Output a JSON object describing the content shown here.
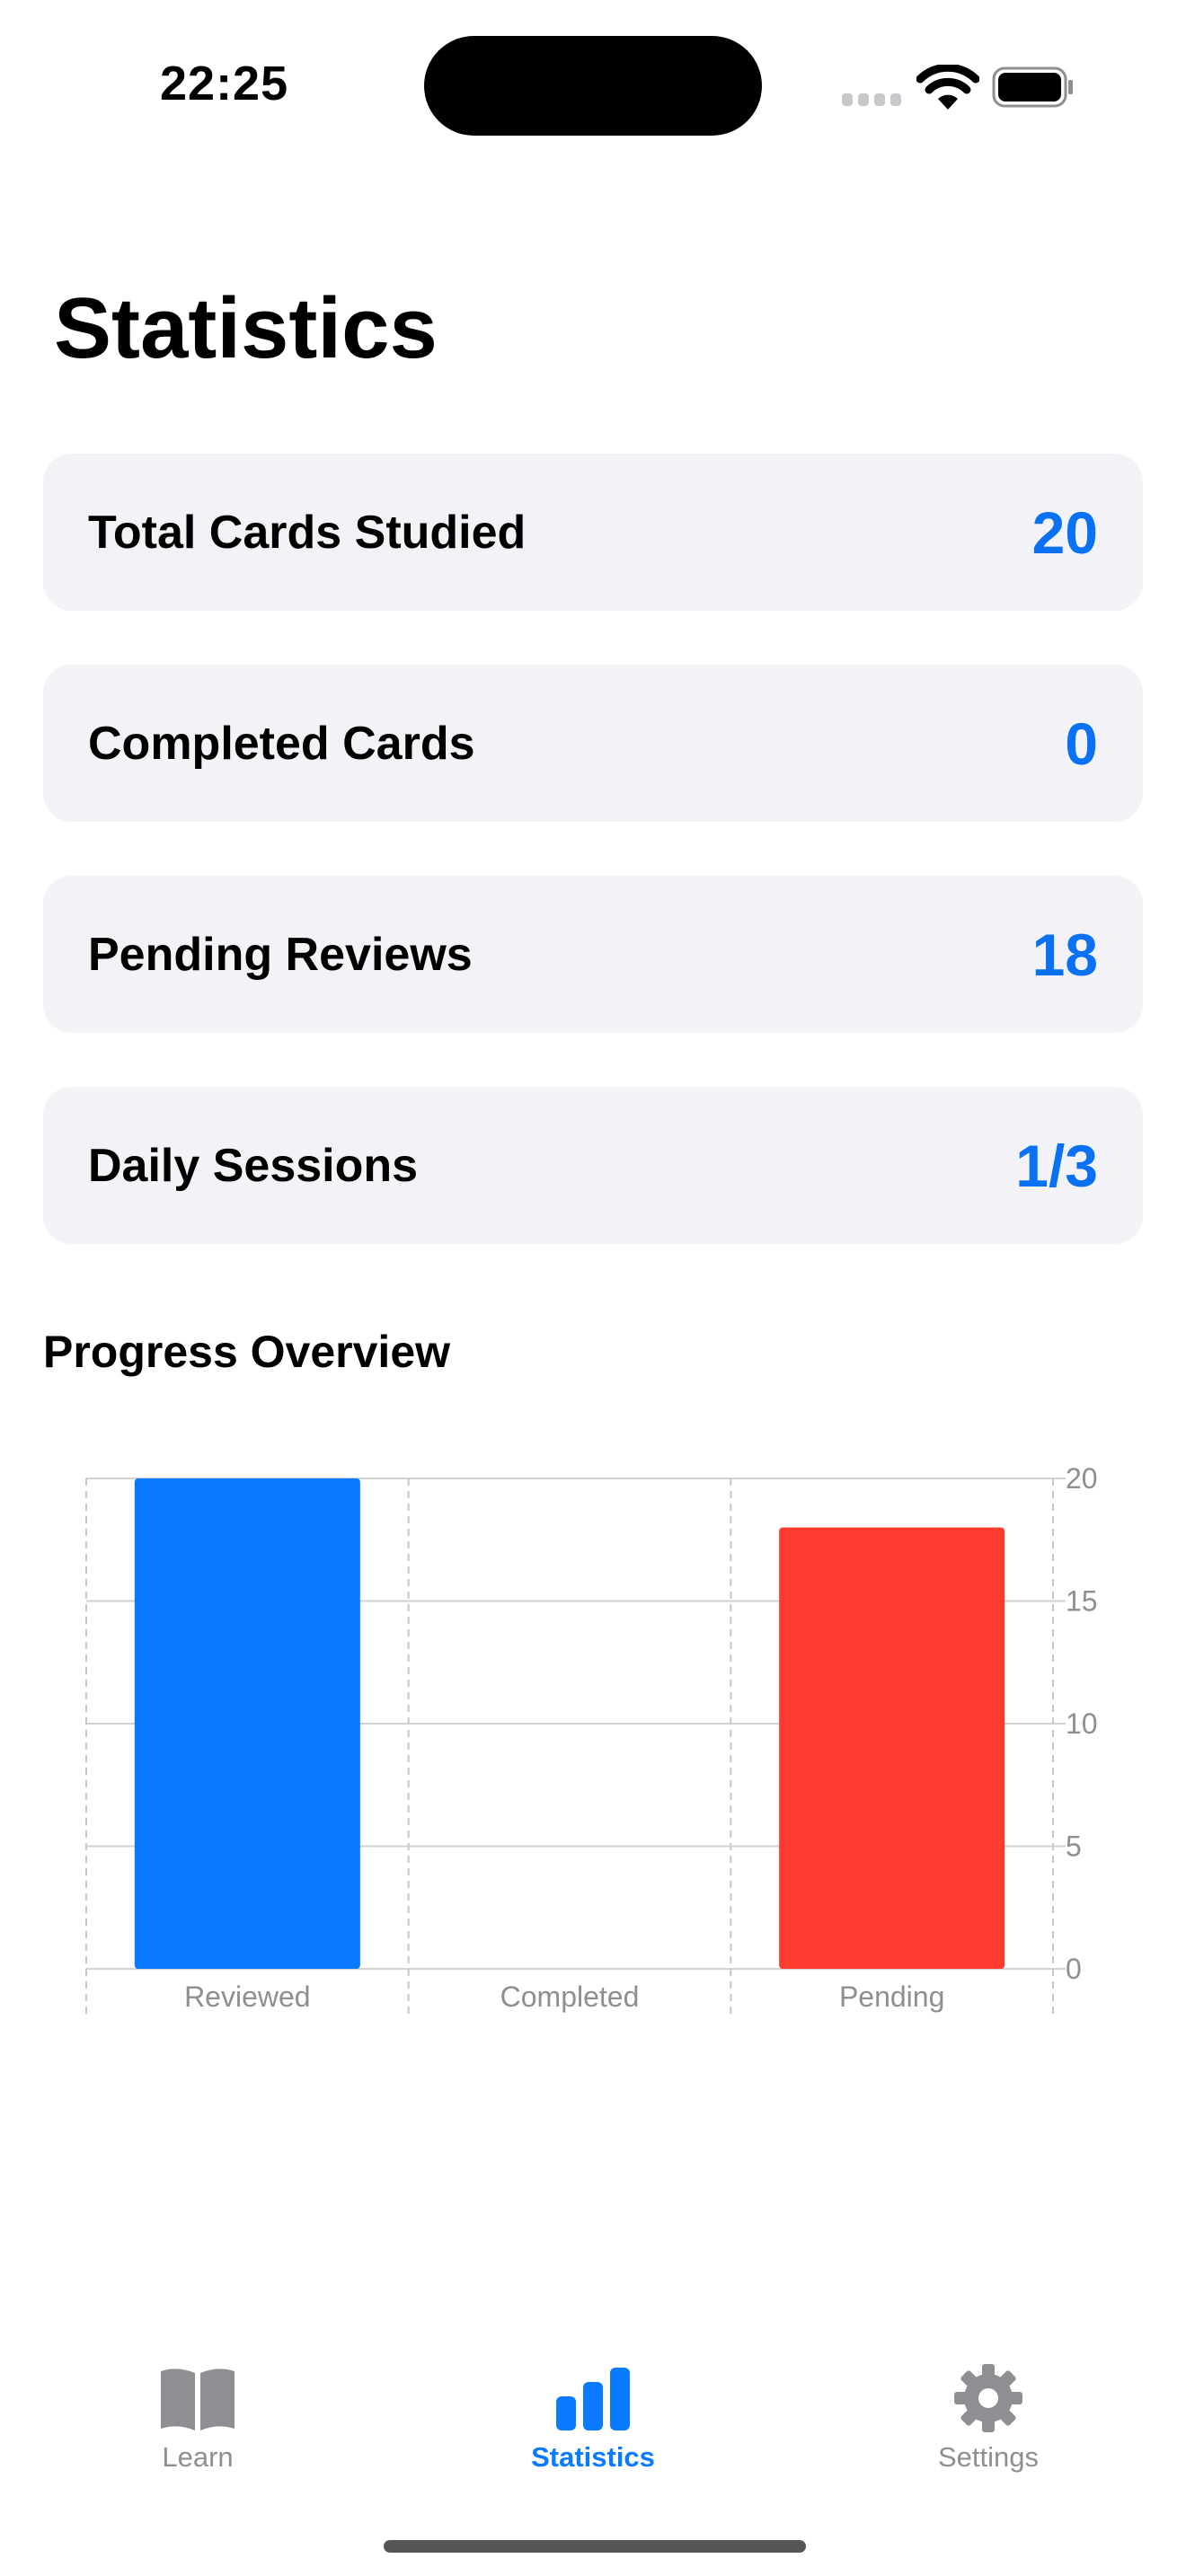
{
  "status_bar": {
    "time": "22:25"
  },
  "page": {
    "title": "Statistics"
  },
  "stats": [
    {
      "label": "Total Cards Studied",
      "value": "20"
    },
    {
      "label": "Completed Cards",
      "value": "0"
    },
    {
      "label": "Pending Reviews",
      "value": "18"
    },
    {
      "label": "Daily Sessions",
      "value": "1/3"
    }
  ],
  "progress": {
    "title": "Progress Overview"
  },
  "chart_data": {
    "type": "bar",
    "title": "Progress Overview",
    "categories": [
      "Reviewed",
      "Completed",
      "Pending"
    ],
    "values": [
      20,
      0,
      18
    ],
    "colors": [
      "#0a7aff",
      "#0a7aff",
      "#ff3b30"
    ],
    "ylim": [
      0,
      20
    ],
    "yticks": [
      0,
      5,
      10,
      15,
      20
    ],
    "y_axis_side": "right",
    "grid": true
  },
  "tabs": [
    {
      "label": "Learn",
      "icon": "book-icon",
      "active": false
    },
    {
      "label": "Statistics",
      "icon": "chart-bar-icon",
      "active": true
    },
    {
      "label": "Settings",
      "icon": "gear-icon",
      "active": false
    }
  ],
  "colors": {
    "accent": "#0a7aff",
    "inactive": "#8e8e93",
    "card_bg": "#f2f2f7",
    "pending": "#ff3b30"
  }
}
